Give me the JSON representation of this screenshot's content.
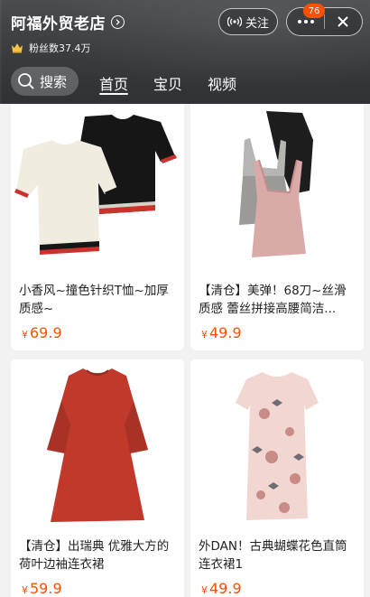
{
  "store": {
    "name": "阿福外贸老店",
    "fans_text": "粉丝数37.4万"
  },
  "header": {
    "follow_label": "关注",
    "badge_count": "76",
    "search_label": "搜索",
    "tabs": [
      {
        "label": "首页",
        "active": true
      },
      {
        "label": "宝贝",
        "active": false
      },
      {
        "label": "视频",
        "active": false
      }
    ]
  },
  "products": [
    {
      "title": "小香风~撞色针织T恤~加厚质感~",
      "currency": "¥",
      "price": "69.9"
    },
    {
      "title": "【清仓】美弹！68刀~丝滑质感  蕾丝拼接高腰简洁...",
      "currency": "¥",
      "price": "49.9"
    },
    {
      "title": "【清仓】出瑞典 优雅大方的荷叶边袖连衣裙",
      "currency": "¥",
      "price": "59.9"
    },
    {
      "title": "外DAN！古典蝴蝶花色直筒连衣裙1",
      "currency": "¥",
      "price": "49.9"
    }
  ],
  "colors": {
    "price": "#ff5000",
    "badge": "#ff5000",
    "header_bg": "#3b3e41"
  },
  "icons": {
    "store_arrow": "chevron-right-circle-icon",
    "fans": "crown-icon",
    "follow": "broadcast-icon",
    "more": "more-dots-icon",
    "close": "close-icon",
    "search": "search-icon"
  }
}
